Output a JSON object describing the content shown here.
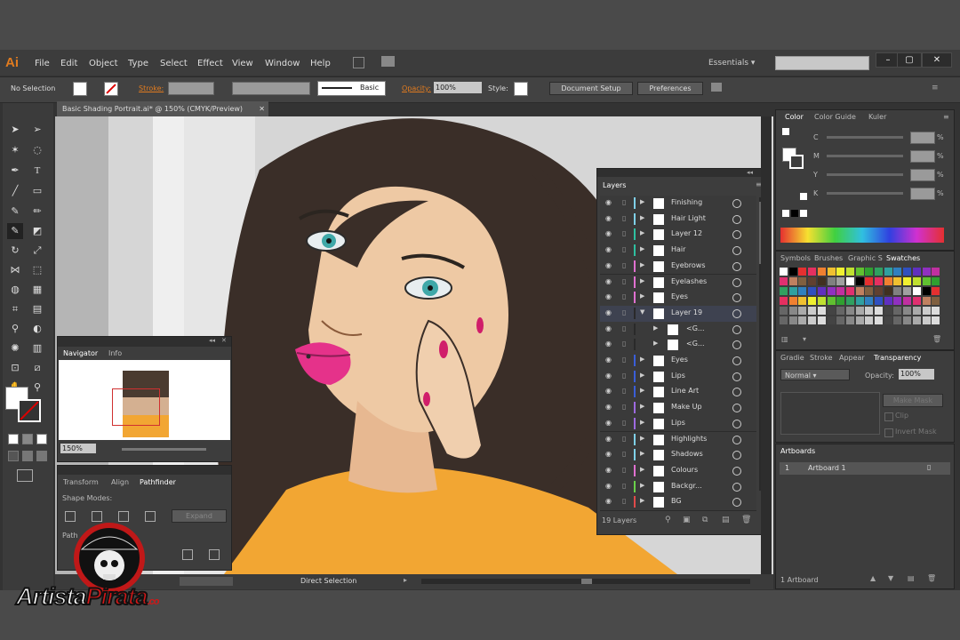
{
  "app": {
    "logo": "Ai"
  },
  "menu": [
    "File",
    "Edit",
    "Object",
    "Type",
    "Select",
    "Effect",
    "View",
    "Window",
    "Help"
  ],
  "workspace": "Essentials",
  "window_buttons": [
    "–",
    "▢",
    "✕"
  ],
  "control": {
    "selection": "No Selection",
    "stroke_label": "Stroke:",
    "brush": "Basic",
    "opacity_label": "Opacity:",
    "opacity": "100%",
    "style_label": "Style:",
    "doc_setup": "Document Setup",
    "preferences": "Preferences"
  },
  "document": {
    "tab": "Basic Shading Portrait.ai* @ 150% (CMYK/Preview)"
  },
  "navigator": {
    "tabs": [
      "Navigator",
      "Info"
    ],
    "zoom": "150%"
  },
  "pathfinder": {
    "tabs": [
      "Transform",
      "Align",
      "Pathfinder"
    ],
    "shape_modes": "Shape Modes:",
    "expand": "Expand",
    "pathfinders": "Path"
  },
  "layers": {
    "tab": "Layers",
    "count": "19 Layers",
    "rows": [
      {
        "name": "Finishing",
        "color": "#7fd0e8",
        "sub": false,
        "open": false
      },
      {
        "name": "Hair Light",
        "color": "#7fd0e8",
        "sub": false,
        "open": false
      },
      {
        "name": "Layer 12",
        "color": "#2ec0a0",
        "sub": false,
        "open": false
      },
      {
        "name": "Hair",
        "color": "#2ec0a0",
        "sub": false,
        "open": false
      },
      {
        "name": "Eyebrows",
        "color": "#e070d0",
        "sub": false,
        "open": false
      },
      {
        "name": "Eyelashes",
        "color": "#e070d0",
        "sub": false,
        "open": false
      },
      {
        "name": "Eyes",
        "color": "#e070d0",
        "sub": false,
        "open": false
      },
      {
        "name": "Layer 19",
        "color": "#2a2a2a",
        "sub": false,
        "open": true
      },
      {
        "name": "<G...",
        "color": "#2a2a2a",
        "sub": true,
        "open": false
      },
      {
        "name": "<G...",
        "color": "#2a2a2a",
        "sub": true,
        "open": false
      },
      {
        "name": "Eyes",
        "color": "#3a5ed8",
        "sub": false,
        "open": false
      },
      {
        "name": "Lips",
        "color": "#3a5ed8",
        "sub": false,
        "open": false
      },
      {
        "name": "Line Art",
        "color": "#3a5ed8",
        "sub": false,
        "open": false
      },
      {
        "name": "Make Up",
        "color": "#9d6ae0",
        "sub": false,
        "open": false
      },
      {
        "name": "Lips",
        "color": "#9d6ae0",
        "sub": false,
        "open": false
      },
      {
        "name": "Highlights",
        "color": "#7fd0e8",
        "sub": false,
        "open": false
      },
      {
        "name": "Shadows",
        "color": "#7fd0e8",
        "sub": false,
        "open": false
      },
      {
        "name": "Colours",
        "color": "#e070d0",
        "sub": false,
        "open": false
      },
      {
        "name": "Backgr...",
        "color": "#6ad04a",
        "sub": false,
        "open": false
      },
      {
        "name": "BG",
        "color": "#e04a4a",
        "sub": false,
        "open": false
      }
    ]
  },
  "color_panel": {
    "tabs": [
      "Color",
      "Color Guide",
      "Kuler"
    ],
    "channels": [
      {
        "label": "C",
        "unit": "%"
      },
      {
        "label": "M",
        "unit": "%"
      },
      {
        "label": "Y",
        "unit": "%"
      },
      {
        "label": "K",
        "unit": "%"
      }
    ]
  },
  "swatches_panel": {
    "tabs": [
      "Symbols",
      "Brushes",
      "Graphic S",
      "Swatches"
    ]
  },
  "transparency_panel": {
    "tabs": [
      "Gradie",
      "Stroke",
      "Appear",
      "Transparency"
    ],
    "mode": "Normal",
    "opacity_label": "Opacity:",
    "opacity": "100%",
    "make_mask": "Make Mask",
    "clip": "Clip",
    "invert_mask": "Invert Mask"
  },
  "artboards_panel": {
    "tab": "Artboards",
    "row_num": "1",
    "row_name": "Artboard 1",
    "footer": "1 Artboard"
  },
  "status": {
    "tool": "Direct Selection"
  },
  "watermark": {
    "text1": "Artista",
    "text2": "Pirata",
    "suffix": ".co"
  },
  "colors": {
    "accent_orange": "#e07b1f",
    "panel": "#3d3d3d",
    "dark": "#333333"
  }
}
